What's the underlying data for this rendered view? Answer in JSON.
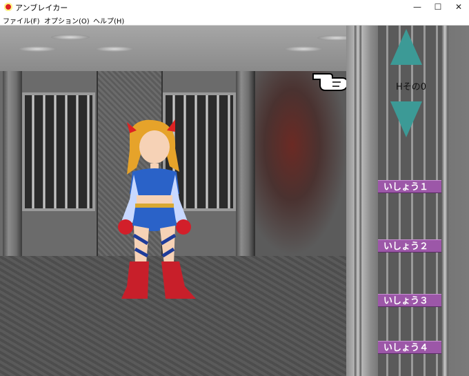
{
  "window": {
    "title": "アンブレイカー",
    "controls": [
      "—",
      "☐",
      "✕"
    ]
  },
  "menubar": {
    "items": [
      "ファイル(F)",
      "オプション(O)",
      "ヘルプ(H)"
    ]
  },
  "game": {
    "scene_label": "Hその0",
    "arrow_up_icon": "triangle-up",
    "arrow_down_icon": "triangle-down",
    "outfit_buttons": [
      "いしょう１",
      "いしょう２",
      "いしょう３",
      "いしょう４"
    ],
    "colors": {
      "arrow": "#3c9a96",
      "outfit_button": "#9c57a8"
    }
  }
}
